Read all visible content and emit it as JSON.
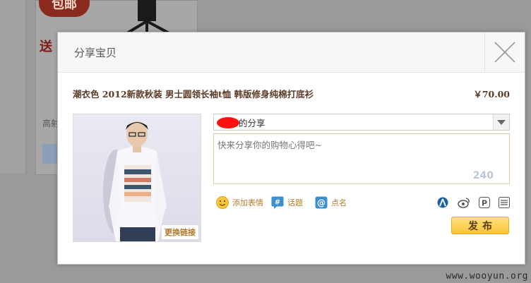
{
  "background": {
    "badge_text": "包邮",
    "send_text": "送",
    "side_text": "高射"
  },
  "dialog": {
    "title": "分享宝贝",
    "close_icon": "close-icon",
    "product_title": "潮衣色 2012新款秋装 男士圆领长袖t恤 韩版修身纯棉打底衫",
    "price": "￥70.00",
    "change_link": "更换链接",
    "share_target_suffix": "的分享",
    "textarea_placeholder": "快来分享你的购物心得吧~",
    "counter": "240",
    "tools": [
      {
        "icon": "smiley-icon",
        "label": "添加表情"
      },
      {
        "icon": "hashtag-icon",
        "label": "话题"
      },
      {
        "icon": "at-icon",
        "label": "点名"
      }
    ],
    "social_icons": [
      "renren-icon",
      "weibo-icon",
      "pengyou-icon",
      "kaixin-icon"
    ],
    "publish_label": "发布"
  },
  "watermark": "www.wooyun.org",
  "colors": {
    "accent_text": "#5b3a24",
    "link_text": "#b07a2c",
    "publish_bg": "#f9c23c",
    "redaction": "#ff1111"
  }
}
